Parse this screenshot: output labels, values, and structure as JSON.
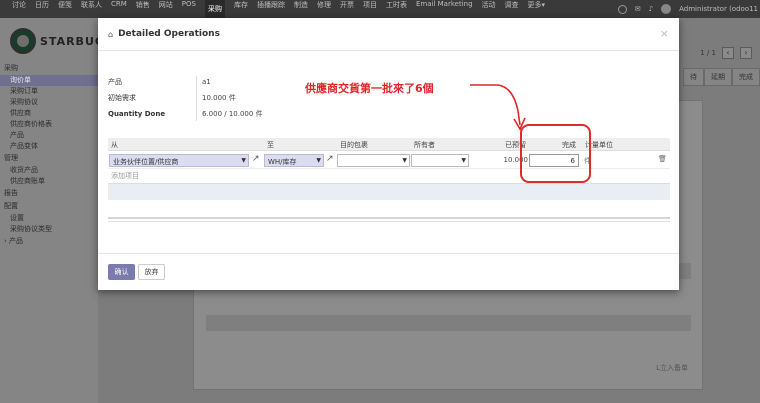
{
  "topnav": [
    "讨论",
    "日历",
    "便笺",
    "联系人",
    "CRM",
    "销售",
    "网站",
    "POS",
    "采购",
    "库存",
    "插播跟踪",
    "制造",
    "修理",
    "开票",
    "项目",
    "工时表",
    "Email Marketing",
    "活动",
    "调查",
    "更多▾"
  ],
  "topnav_active": "采购",
  "user": "Administrator (odoo11",
  "brand": "STARBUC",
  "sidebar": [
    {
      "label": "采购",
      "type": "header"
    },
    {
      "label": "询价单",
      "type": "item",
      "selected": true
    },
    {
      "label": "采购订单",
      "type": "item"
    },
    {
      "label": "采购协议",
      "type": "item"
    },
    {
      "label": "供应商",
      "type": "item"
    },
    {
      "label": "供应商价格表",
      "type": "item"
    },
    {
      "label": "产品",
      "type": "item"
    },
    {
      "label": "产品变体",
      "type": "item"
    },
    {
      "label": "管理",
      "type": "header"
    },
    {
      "label": "收货产品",
      "type": "item"
    },
    {
      "label": "供应商账单",
      "type": "item"
    },
    {
      "label": "报告",
      "type": "header"
    },
    {
      "label": "配置",
      "type": "header"
    },
    {
      "label": "设置",
      "type": "item"
    },
    {
      "label": "采购协议类型",
      "type": "item"
    },
    {
      "label": "› 产品",
      "type": "header"
    }
  ],
  "pager": {
    "text": "1 / 1",
    "prev": "‹",
    "next": "›"
  },
  "statusbar": [
    "待",
    "延期",
    "完成"
  ],
  "sheet_footer": "L立入备单",
  "modal": {
    "title": "Detailed Operations",
    "close": "×",
    "info": [
      {
        "label": "产品",
        "value": "a1",
        "bold": false
      },
      {
        "label": "初始需求",
        "value": "10.000 件",
        "bold": false
      },
      {
        "label": "Quantity Done",
        "value": "6.000 / 10.000 件",
        "bold": true
      }
    ],
    "annotation": "供應商交貨第一批來了6個",
    "columns": {
      "from": "从",
      "to": "至",
      "dest_pkg": "目的包裹",
      "owner": "所有者",
      "reserved": "已预留",
      "done": "完成",
      "uom": "计量单位"
    },
    "row": {
      "from": "业务伙伴位置/供应商",
      "to": "WH/库存",
      "reserved": "10.000",
      "done": "6",
      "uom": "件"
    },
    "add_line": "添加项目",
    "confirm": "确认",
    "discard": "放弃"
  }
}
